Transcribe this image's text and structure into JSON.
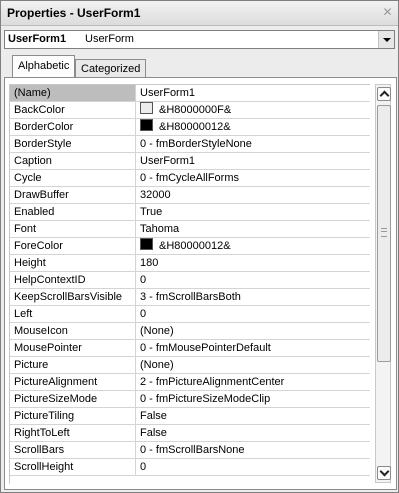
{
  "window": {
    "title": "Properties - UserForm1",
    "close_symbol": "✕"
  },
  "object_selector": {
    "name": "UserForm1",
    "type": "UserForm"
  },
  "tabs": [
    {
      "label": "Alphabetic",
      "active": true
    },
    {
      "label": "Categorized",
      "active": false
    }
  ],
  "properties": [
    {
      "name": "(Name)",
      "value": "UserForm1"
    },
    {
      "name": "BackColor",
      "value": "&H8000000F&",
      "swatch": "#ececec"
    },
    {
      "name": "BorderColor",
      "value": "&H80000012&",
      "swatch": "#000000"
    },
    {
      "name": "BorderStyle",
      "value": "0 - fmBorderStyleNone"
    },
    {
      "name": "Caption",
      "value": "UserForm1"
    },
    {
      "name": "Cycle",
      "value": "0 - fmCycleAllForms"
    },
    {
      "name": "DrawBuffer",
      "value": "32000"
    },
    {
      "name": "Enabled",
      "value": "True"
    },
    {
      "name": "Font",
      "value": "Tahoma"
    },
    {
      "name": "ForeColor",
      "value": "&H80000012&",
      "swatch": "#000000"
    },
    {
      "name": "Height",
      "value": "180"
    },
    {
      "name": "HelpContextID",
      "value": "0"
    },
    {
      "name": "KeepScrollBarsVisible",
      "value": "3 - fmScrollBarsBoth"
    },
    {
      "name": "Left",
      "value": "0"
    },
    {
      "name": "MouseIcon",
      "value": "(None)"
    },
    {
      "name": "MousePointer",
      "value": "0 - fmMousePointerDefault"
    },
    {
      "name": "Picture",
      "value": "(None)"
    },
    {
      "name": "PictureAlignment",
      "value": "2 - fmPictureAlignmentCenter"
    },
    {
      "name": "PictureSizeMode",
      "value": "0 - fmPictureSizeModeClip"
    },
    {
      "name": "PictureTiling",
      "value": "False"
    },
    {
      "name": "RightToLeft",
      "value": "False"
    },
    {
      "name": "ScrollBars",
      "value": "0 - fmScrollBarsNone"
    },
    {
      "name": "ScrollHeight",
      "value": "0"
    }
  ],
  "selected_row": 0
}
